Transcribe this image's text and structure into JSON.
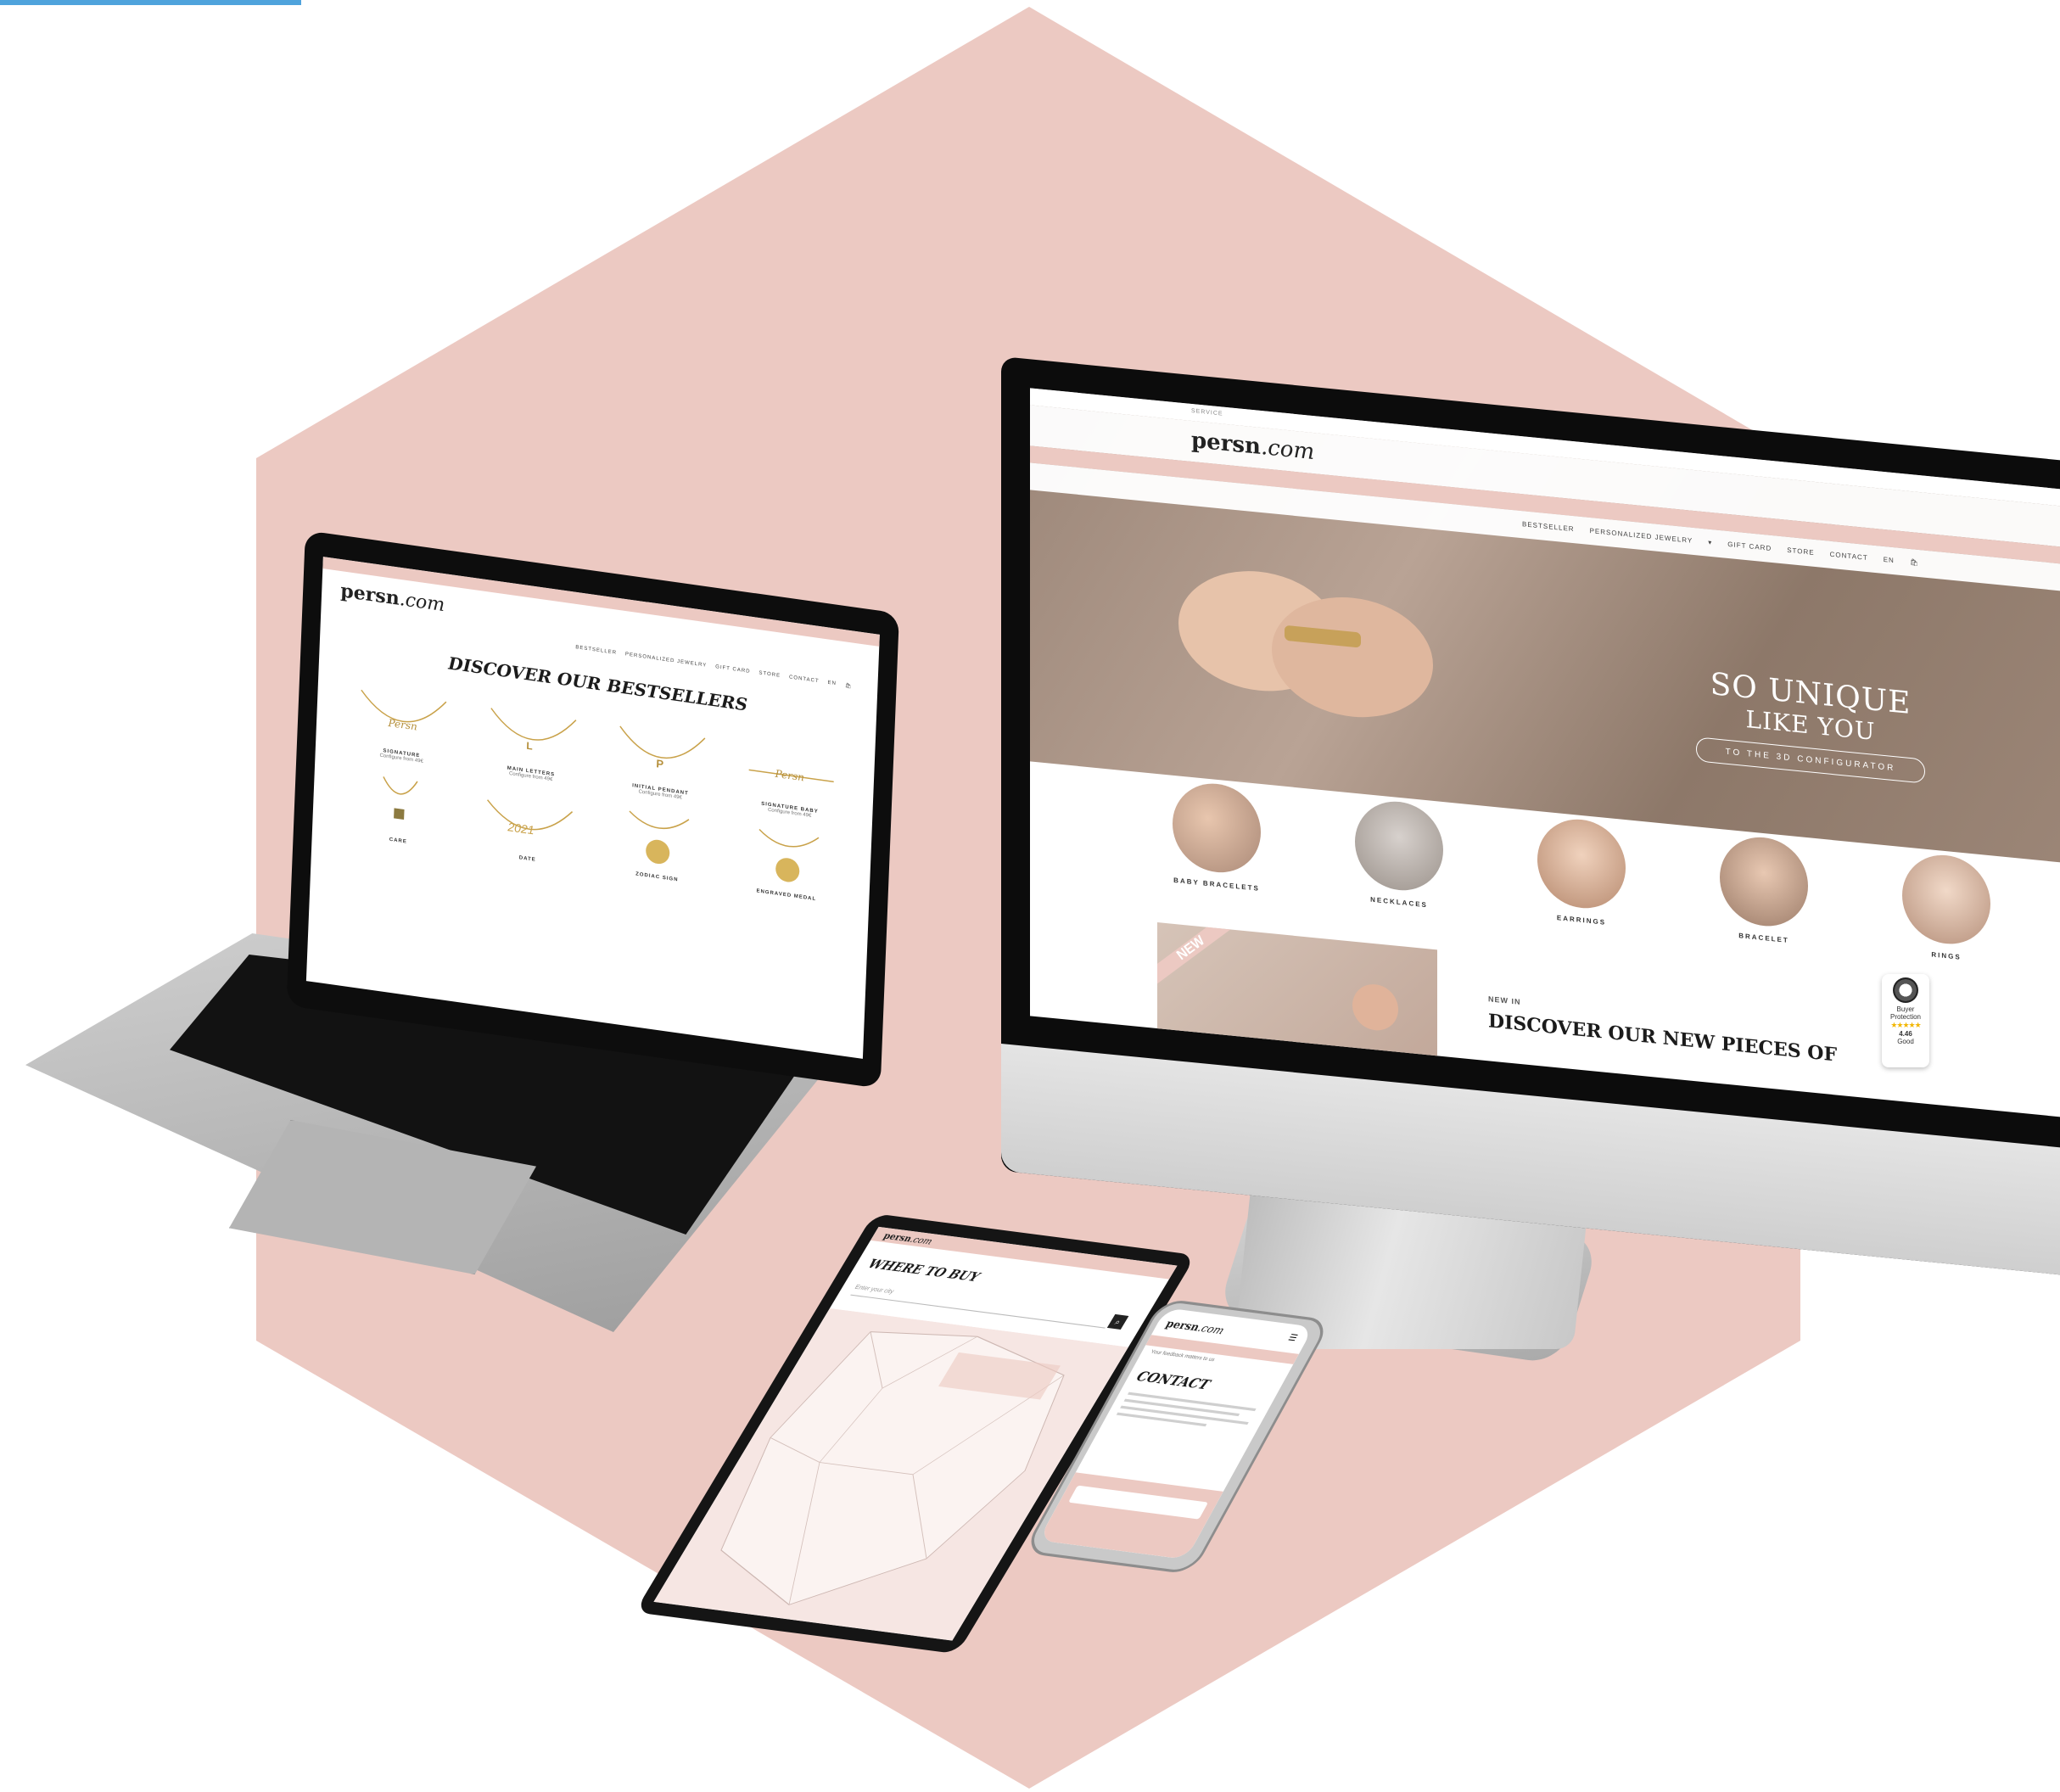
{
  "brand": {
    "logo_main": "persn",
    "logo_suffix": ".com",
    "colors": {
      "brand_pink": "#ecc9c2",
      "accent_blue": "#4fa3dc",
      "text_dark": "#1b1b1b"
    }
  },
  "monitor": {
    "service_label": "SERVICE",
    "nav": [
      "BESTSELLER",
      "PERSONALIZED JEWELRY",
      "GIFT CARD",
      "STORE",
      "CONTACT"
    ],
    "language": "EN",
    "hero_title_1": "SO UNIQUE",
    "hero_title_2": "LIKE YOU",
    "hero_button": "TO THE 3D CONFIGURATOR",
    "categories": [
      "BABY BRACELETS",
      "NECKLACES",
      "EARRINGS",
      "BRACELET",
      "RINGS"
    ],
    "new_badge": "NEW",
    "new_label": "NEW IN",
    "new_heading": "DISCOVER OUR NEW PIECES OF"
  },
  "trust_badge": {
    "label_1": "Buyer",
    "label_2": "Protection",
    "stars": "★★★★★",
    "rating": "4.46",
    "rating_word": "Good"
  },
  "laptop": {
    "nav": [
      "BESTSELLER",
      "PERSONALIZED JEWELRY",
      "GIFT CARD",
      "STORE",
      "CONTACT"
    ],
    "language": "EN",
    "heading": "DISCOVER OUR BESTSELLERS",
    "products": [
      {
        "name": "SIGNATURE",
        "price": "Configure from 49€"
      },
      {
        "name": "MAIN LETTERS",
        "price": "Configure from 49€"
      },
      {
        "name": "INITIAL PENDANT",
        "price": "Configure from 49€"
      },
      {
        "name": "SIGNATURE BABY",
        "price": "Configure from 49€"
      },
      {
        "name": "CARE",
        "price": ""
      },
      {
        "name": "DATE",
        "price": ""
      },
      {
        "name": "ZODIAC SIGN",
        "price": ""
      },
      {
        "name": "ENGRAVED MEDAL",
        "price": ""
      }
    ]
  },
  "tablet": {
    "heading": "WHERE TO BUY",
    "search_placeholder": "Enter your city"
  },
  "phone": {
    "heading": "CONTACT",
    "subtitle": "Your feedback matters to us"
  }
}
